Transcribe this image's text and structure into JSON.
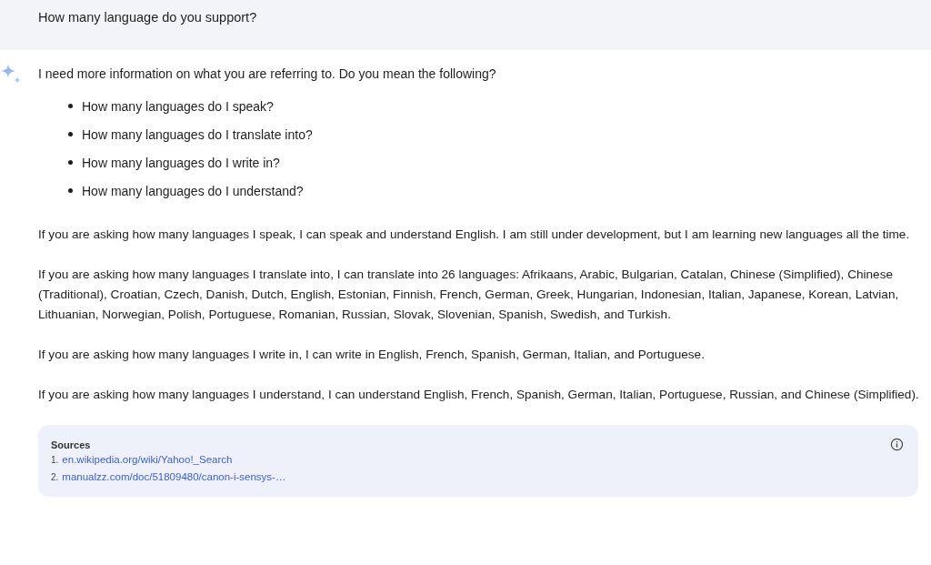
{
  "prompt": {
    "text": "How many language do you support?"
  },
  "response": {
    "intro": "I need more information on what you are referring to. Do you mean the following?",
    "bullets": [
      "How many languages do I speak?",
      "How many languages do I translate into?",
      "How many languages do I write in?",
      "How many languages do I understand?"
    ],
    "paragraphs": [
      "If you are asking how many languages I speak, I can speak and understand English. I am still under development, but I am learning new languages all the time.",
      "If you are asking how many languages I translate into, I can translate into 26 languages: Afrikaans, Arabic, Bulgarian, Catalan, Chinese (Simplified), Chinese (Traditional), Croatian, Czech, Danish, Dutch, English, Estonian, Finnish, French, German, Greek, Hungarian, Indonesian, Italian, Japanese, Korean, Latvian, Lithuanian, Norwegian, Polish, Portuguese, Romanian, Russian, Slovak, Slovenian, Spanish, Swedish, and Turkish.",
      "If you are asking how many languages I write in, I can write in English, French, Spanish, German, Italian, and Portuguese.",
      "If you are asking how many languages I understand, I can understand English, French, Spanish, German, Italian, Portuguese, Russian, and Chinese (Simplified)."
    ]
  },
  "sources": {
    "title": "Sources",
    "items": [
      {
        "number": "1.",
        "link": "en.wikipedia.org/wiki/Yahoo!_Search"
      },
      {
        "number": "2.",
        "link": "manualzz.com/doc/51809480/canon-i-sensys-…"
      }
    ]
  }
}
